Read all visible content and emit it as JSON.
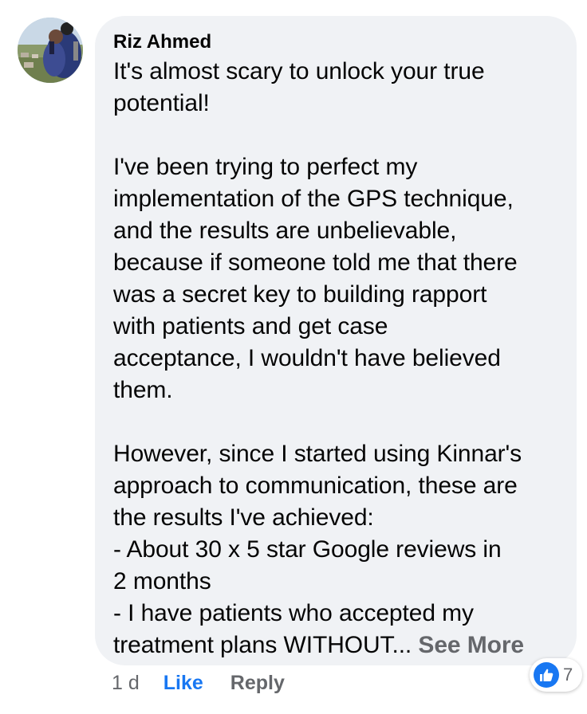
{
  "comment": {
    "author": "Riz Ahmed",
    "lines_p1": [
      "It's almost scary to unlock your true",
      "potential!"
    ],
    "lines_p2": [
      "I've been trying to perfect my",
      "implementation of the GPS technique,",
      "and the results are unbelievable,",
      "because if someone told me that there",
      "was a secret key to building rapport",
      "with patients and get case",
      "acceptance, I wouldn't have believed",
      "them."
    ],
    "lines_p3": [
      "However, since I started using Kinnar's",
      "approach to communication, these are",
      "the results I've achieved:",
      "- About 30 x 5 star Google reviews in",
      "2 months",
      "- I have patients who accepted my"
    ],
    "last_line": "treatment plans WITHOUT...",
    "see_more": "See More"
  },
  "actions": {
    "timestamp": "1 d",
    "like": "Like",
    "reply": "Reply"
  },
  "reactions": {
    "icon": "thumbs-up-icon",
    "count": "7",
    "color": "#1877f2"
  },
  "colors": {
    "bubble": "#f0f2f5",
    "link": "#1877f2",
    "muted": "#65676b"
  }
}
